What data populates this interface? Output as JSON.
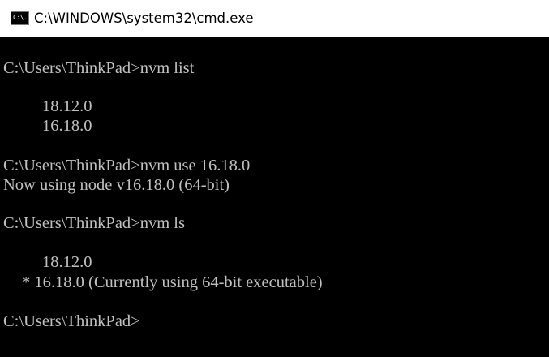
{
  "window": {
    "title": "C:\\WINDOWS\\system32\\cmd.exe",
    "icon_name": "cmd-icon",
    "icon_text": "C:\\."
  },
  "console": {
    "lines": [
      "C:\\Users\\ThinkPad>nvm list",
      "18.12.0",
      "16.18.0",
      "C:\\Users\\ThinkPad>nvm use 16.18.0",
      "Now using node v16.18.0 (64-bit)",
      "C:\\Users\\ThinkPad>nvm ls",
      "18.12.0",
      "* 16.18.0 (Currently using 64-bit executable)",
      "C:\\Users\\ThinkPad>"
    ]
  },
  "colors": {
    "console_background": "#000000",
    "console_text": "#c0c0c0",
    "titlebar_background": "#ffffff"
  }
}
